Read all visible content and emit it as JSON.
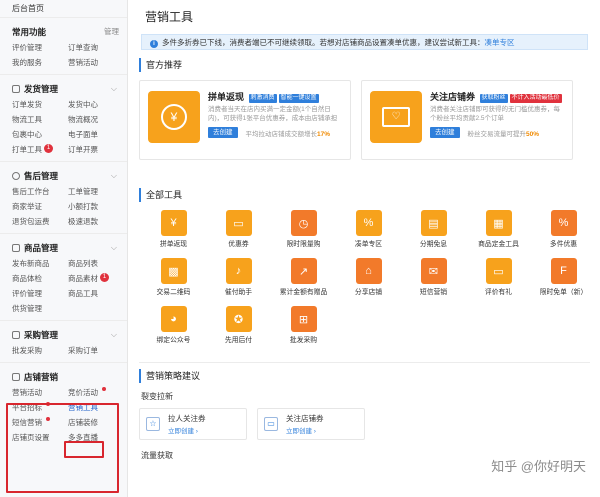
{
  "sidebar": {
    "home": "后台首页",
    "sections": [
      {
        "title": "常用功能",
        "manage": "管理",
        "items": [
          "评价管理",
          "订单查询",
          "我的服务",
          "营销活动"
        ]
      },
      {
        "title": "发货管理",
        "items": [
          "订单发货",
          "发货中心",
          "物流工具",
          "物流概况",
          "包裹中心",
          "电子面单",
          "打单工具",
          "订单开票"
        ],
        "badge": "1"
      },
      {
        "title": "售后管理",
        "items": [
          "售后工作台",
          "工单管理",
          "商家举证",
          "小额打款",
          "退货包运费",
          "极速退款"
        ]
      },
      {
        "title": "商品管理",
        "items": [
          "发布新商品",
          "商品列表",
          "商品体检",
          "商品素材",
          "评价管理",
          "商品工具",
          "供货管理"
        ],
        "badge": "1"
      },
      {
        "title": "采购管理",
        "items": [
          "批发采购",
          "采购订单"
        ]
      },
      {
        "title": "店铺营销",
        "items": [
          "营销活动",
          "竞价活动",
          "平台招标",
          "营销工具",
          "短信营销",
          "店铺装修",
          "店铺页设置",
          "多多直播"
        ]
      }
    ]
  },
  "main": {
    "title": "营销工具",
    "notice": {
      "text": "多件多折券已下线，消费者端已不可继续领取。若想对店铺商品设置凑单优惠，建议尝试新工具：",
      "link": "凑单专区"
    },
    "featured_title": "官方推荐",
    "featured": [
      {
        "name": "拼单返现",
        "tags": [
          "刺激消费",
          "智能一键设置"
        ],
        "desc": "消费者当天在店内买满一定金额(1个自然日内)，可获得1张平台优惠券，成本由店铺承担",
        "button": "去创建",
        "metric_pre": "平均拉动店铺成交额增长",
        "metric_val": "17%",
        "color": "#f7a21c"
      },
      {
        "name": "关注店铺券",
        "tags": [
          "获取粉丝",
          "不计入活动最低价"
        ],
        "desc": "消费者关注店铺即可获得的无门槛优惠券，每个粉丝平均贡献2.5个订单",
        "button": "去创建",
        "metric_pre": "粉丝交易流量可提升",
        "metric_val": "50%",
        "color": "#f7a21c"
      }
    ],
    "all_tools_title": "全部工具",
    "tools": [
      {
        "label": "拼单返现",
        "icon": "coin-icon",
        "glyph": "¥",
        "color": "#f7a21c"
      },
      {
        "label": "优惠券",
        "icon": "coupon-icon",
        "glyph": "▭",
        "color": "#f7a21c"
      },
      {
        "label": "限时限量购",
        "icon": "clock-icon",
        "glyph": "◷",
        "color": "#f27a2a"
      },
      {
        "label": "凑单专区",
        "icon": "percent-icon",
        "glyph": "%",
        "color": "#f7a21c"
      },
      {
        "label": "分期免息",
        "icon": "card-icon",
        "glyph": "▤",
        "color": "#f7a21c"
      },
      {
        "label": "商品定金工具",
        "icon": "deposit-icon",
        "glyph": "▦",
        "color": "#f7a21c"
      },
      {
        "label": "多件优惠",
        "icon": "discount-icon",
        "glyph": "%",
        "color": "#f27a2a"
      },
      {
        "label": "交易二维码",
        "icon": "qrcode-icon",
        "glyph": "▩",
        "color": "#f7a21c"
      },
      {
        "label": "催付助手",
        "icon": "bell-icon",
        "glyph": "♪",
        "color": "#f7a21c"
      },
      {
        "label": "累计金额有赠品",
        "icon": "chart-icon",
        "glyph": "↗",
        "color": "#f27a2a"
      },
      {
        "label": "分享店铺",
        "icon": "share-icon",
        "glyph": "⌂",
        "color": "#f27a2a"
      },
      {
        "label": "短信营销",
        "icon": "sms-icon",
        "glyph": "✉",
        "color": "#f27a2a"
      },
      {
        "label": "评价有礼",
        "icon": "comment-icon",
        "glyph": "▭",
        "color": "#f7a21c"
      },
      {
        "label": "限时免单（新）",
        "icon": "free-icon",
        "glyph": "F",
        "color": "#f27a2a"
      },
      {
        "label": "绑定公众号",
        "icon": "wechat-icon",
        "glyph": "◕",
        "color": "#f7a21c"
      },
      {
        "label": "先用后付",
        "icon": "badge-icon",
        "glyph": "✪",
        "color": "#f7a21c"
      },
      {
        "label": "批发采购",
        "icon": "cart-icon",
        "glyph": "⊞",
        "color": "#f27a2a"
      }
    ],
    "strategy_title": "营销策略建议",
    "fission_title": "裂变拉新",
    "fission_cards": [
      {
        "name": "拉人关注券",
        "link": "立即创建 ›"
      },
      {
        "name": "关注店铺券",
        "link": "立即创建 ›"
      }
    ],
    "traffic_title": "流量获取"
  },
  "watermark": "知乎 @你好明天"
}
